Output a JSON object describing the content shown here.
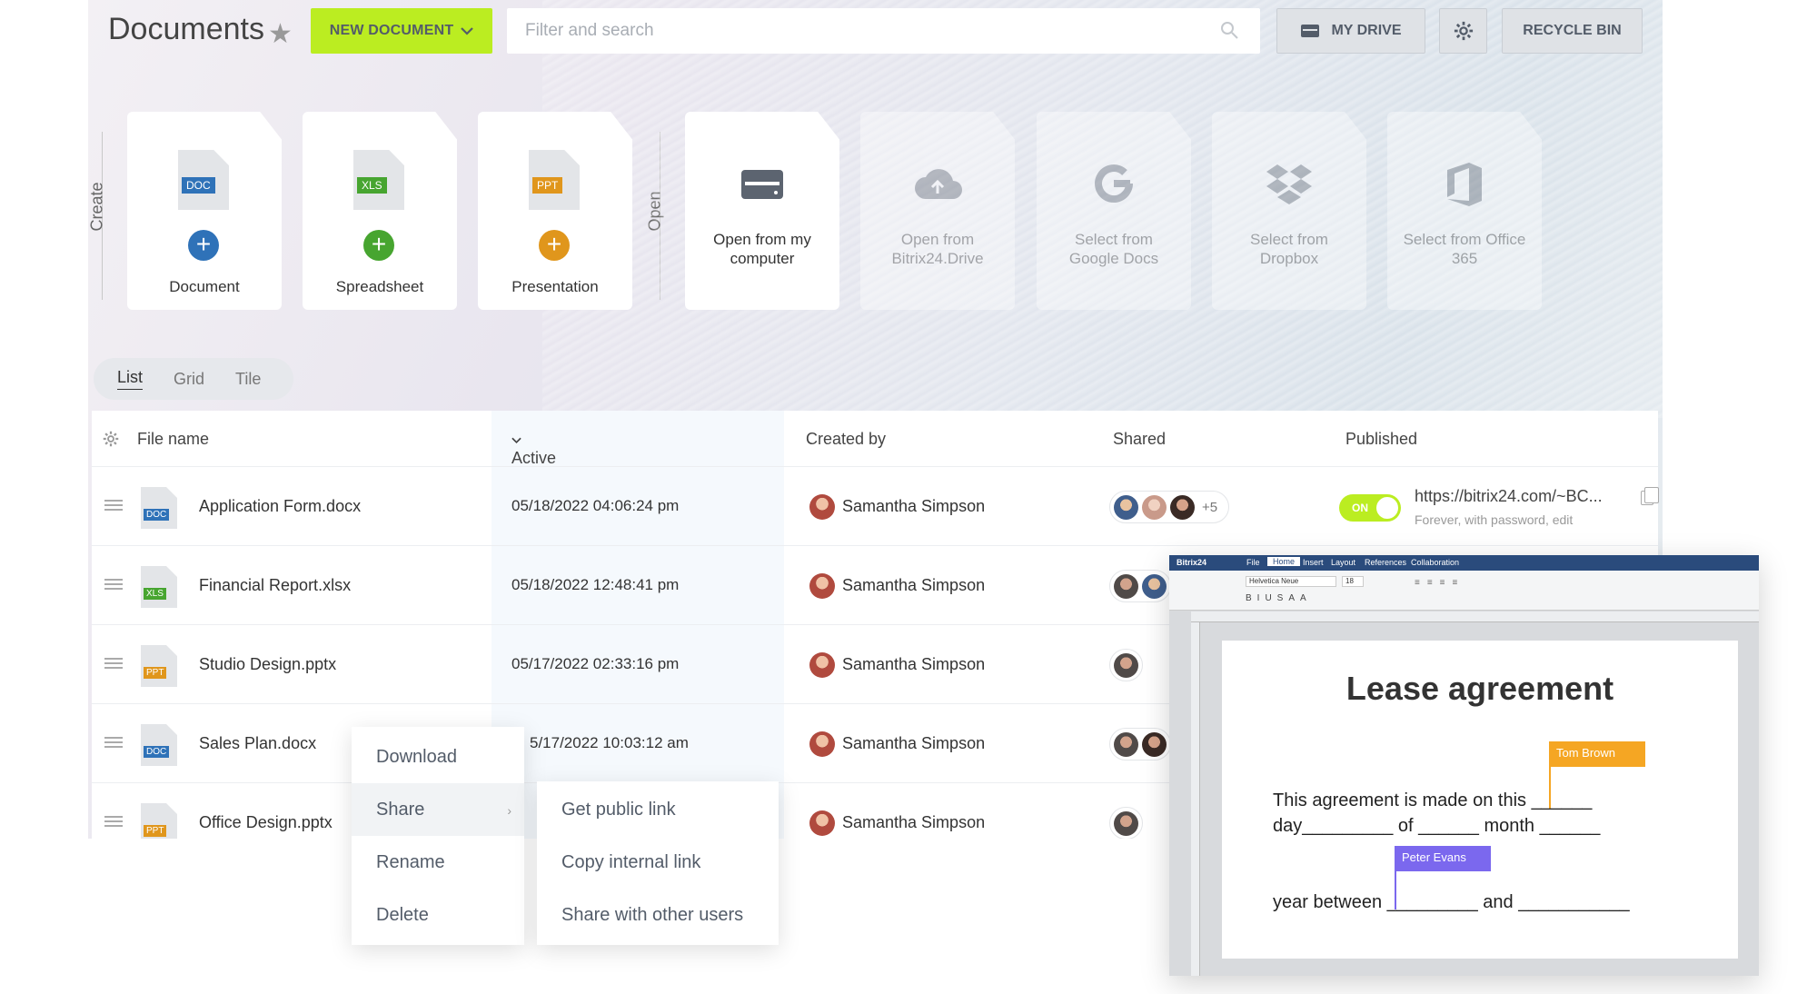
{
  "header": {
    "title": "Documents",
    "new_doc": "NEW DOCUMENT",
    "search_placeholder": "Filter and search",
    "my_drive": "MY DRIVE",
    "recycle_bin": "RECYCLE BIN"
  },
  "sections": {
    "create": "Create",
    "open": "Open"
  },
  "create_tiles": [
    {
      "tag": "DOC",
      "label": "Document",
      "tag_color": "#2f72b8",
      "plus_color": "#2f72b8"
    },
    {
      "tag": "XLS",
      "label": "Spreadsheet",
      "tag_color": "#47a530",
      "plus_color": "#47a530"
    },
    {
      "tag": "PPT",
      "label": "Presentation",
      "tag_color": "#e0961c",
      "plus_color": "#e0961c"
    }
  ],
  "open_tiles": [
    {
      "line1": "Open from my",
      "line2": "computer",
      "icon": "drive-icon"
    },
    {
      "line1": "Open from",
      "line2": "Bitrix24.Drive",
      "icon": "cloud-upload-icon"
    },
    {
      "line1": "Select from",
      "line2": "Google Docs",
      "icon": "google-icon"
    },
    {
      "line1": "Select from",
      "line2": "Dropbox",
      "icon": "dropbox-icon"
    },
    {
      "line1": "Select from Office",
      "line2": "365",
      "icon": "office-icon"
    }
  ],
  "view_tabs": [
    "List",
    "Grid",
    "Tile"
  ],
  "columns": {
    "file_name": "File name",
    "active": "Active",
    "created_by": "Created by",
    "shared": "Shared",
    "published": "Published"
  },
  "rows": [
    {
      "name": "Application Form.docx",
      "type": "DOC",
      "date": "05/18/2022 04:06:24 pm",
      "creator": "Samantha Simpson",
      "shared_more": "+5"
    },
    {
      "name": "Financial Report.xlsx",
      "type": "XLS",
      "date": "05/18/2022 12:48:41 pm",
      "creator": "Samantha Simpson"
    },
    {
      "name": "Studio Design.pptx",
      "type": "PPT",
      "date": "05/17/2022 02:33:16 pm",
      "creator": "Samantha Simpson"
    },
    {
      "name": "Sales Plan.docx",
      "type": "DOC",
      "date": "5/17/2022 10:03:12 am",
      "creator": "Samantha Simpson"
    },
    {
      "name": "Office Design.pptx",
      "type": "PPT",
      "date": "5/",
      "creator": "Samantha Simpson"
    }
  ],
  "published": {
    "toggle": "ON",
    "link": "https://bitrix24.com/~BC...",
    "sub": "Forever, with password, edit"
  },
  "context_menu": [
    "Download",
    "Share",
    "Rename",
    "Delete"
  ],
  "share_menu": [
    "Get public link",
    "Copy internal link",
    "Share with other users"
  ],
  "editor": {
    "brand": "Bitrix24",
    "tabs": [
      "File",
      "Home",
      "Insert",
      "Layout",
      "References",
      "Collaboration"
    ],
    "font": "Helvetica Neue",
    "font_size": "18",
    "doc_title": "Lease agreement",
    "line1": "This agreement is made on this ______",
    "line2": "day_________ of ______ month ______",
    "line3": "year between _________ and ___________",
    "tag1": "Tom Brown",
    "tag2": "Peter Evans",
    "tag1_color": "#f5a623",
    "tag2_color": "#7b68ee"
  }
}
